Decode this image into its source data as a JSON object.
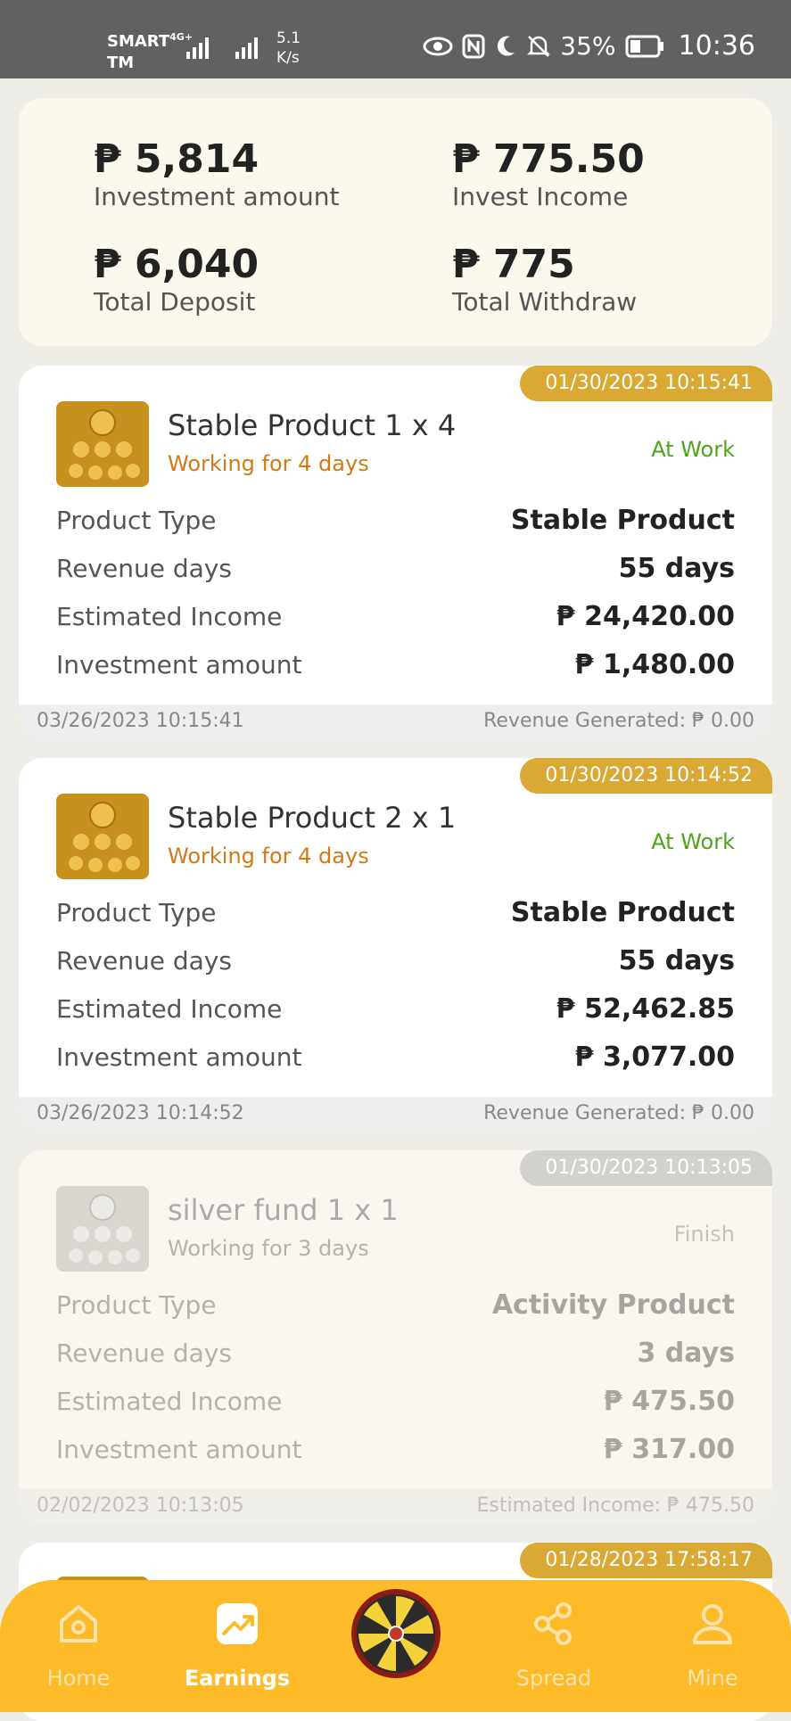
{
  "status_bar": {
    "carrier_line1": "SMART",
    "carrier_line2": "TM",
    "network": "4G+",
    "speed_value": "5.1",
    "speed_unit": "K/s",
    "battery": "35%",
    "time": "10:36"
  },
  "summary": {
    "investment_amount": {
      "value": "₱ 5,814",
      "label": "Investment amount"
    },
    "invest_income": {
      "value": "₱ 775.50",
      "label": "Invest Income"
    },
    "total_deposit": {
      "value": "₱ 6,040",
      "label": "Total Deposit"
    },
    "total_withdraw": {
      "value": "₱ 775",
      "label": "Total Withdraw"
    }
  },
  "row_labels": {
    "product_type": "Product Type",
    "revenue_days": "Revenue days",
    "estimated_income": "Estimated Income",
    "investment_amount": "Investment amount"
  },
  "products": [
    {
      "stamp": "01/30/2023 10:15:41",
      "name": "Stable Product 1 x 4",
      "working": "Working for 4 days",
      "status": "At Work",
      "product_type": "Stable Product",
      "revenue_days": "55 days",
      "estimated_income": "₱ 24,420.00",
      "investment_amount": "₱ 1,480.00",
      "foot_left": "03/26/2023 10:15:41",
      "foot_right": "Revenue Generated: ₱ 0.00"
    },
    {
      "stamp": "01/30/2023 10:14:52",
      "name": "Stable Product 2 x 1",
      "working": "Working for 4 days",
      "status": "At Work",
      "product_type": "Stable Product",
      "revenue_days": "55 days",
      "estimated_income": "₱ 52,462.85",
      "investment_amount": "₱ 3,077.00",
      "foot_left": "03/26/2023 10:14:52",
      "foot_right": "Revenue Generated: ₱ 0.00"
    },
    {
      "stamp": "01/30/2023 10:13:05",
      "name": "silver fund 1 x 1",
      "working": "Working for 3 days",
      "status": "Finish",
      "product_type": "Activity Product",
      "revenue_days": "3 days",
      "estimated_income": "₱ 475.50",
      "investment_amount": "₱ 317.00",
      "foot_left": "02/02/2023 10:13:05",
      "foot_right": "Estimated Income: ₱ 475.50"
    },
    {
      "stamp": "01/28/2023 17:58:17"
    }
  ],
  "nav": {
    "home": "Home",
    "earnings": "Earnings",
    "spread": "Spread",
    "mine": "Mine"
  },
  "colors": {
    "accent": "#fdbb2a",
    "stamp": "#d9a934",
    "working": "#d27a14",
    "at_work": "#4ea51a"
  }
}
